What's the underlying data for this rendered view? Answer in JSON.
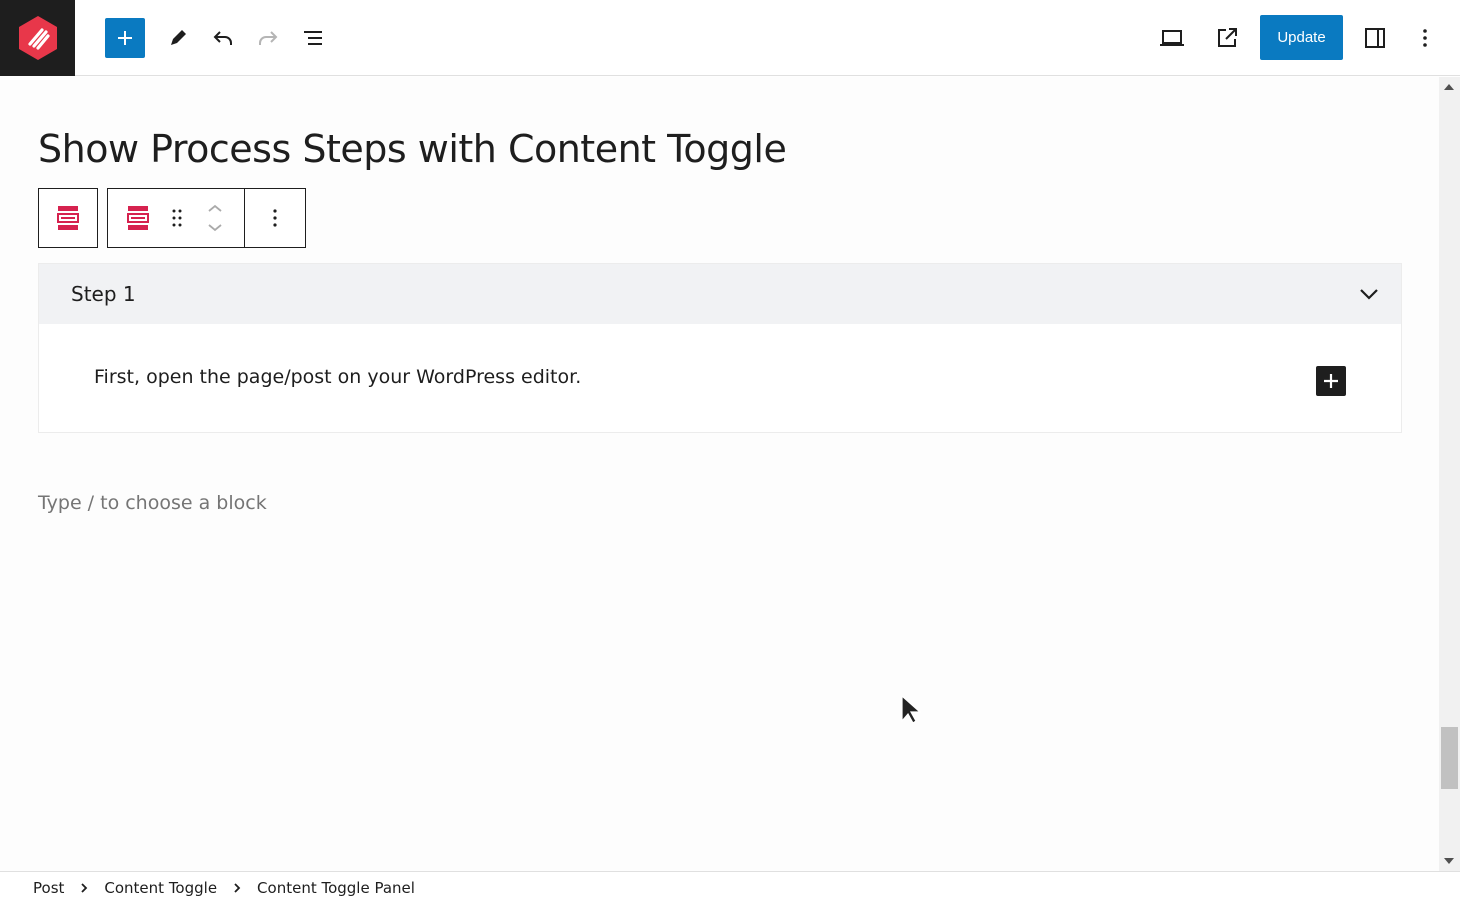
{
  "colors": {
    "accent": "#0a7ac1",
    "logo_bg": "#1e1e1e",
    "logo_mark": "#e8374a",
    "block_icon": "#d6224f",
    "panel_head": "#f1f2f4"
  },
  "header": {
    "icons": [
      "plus-icon",
      "pencil-icon",
      "undo-icon",
      "redo-icon",
      "list-view-icon",
      "desktop-preview-icon",
      "external-link-icon",
      "sidebar-toggle-icon",
      "kebab-menu-icon"
    ],
    "update_label": "Update"
  },
  "editor": {
    "title": "Show Process Steps with Content Toggle",
    "panel": {
      "title": "Step 1",
      "body": "First, open the page/post on your WordPress editor."
    },
    "placeholder": "Type / to choose a block"
  },
  "breadcrumb": [
    "Post",
    "Content Toggle",
    "Content Toggle Panel"
  ]
}
